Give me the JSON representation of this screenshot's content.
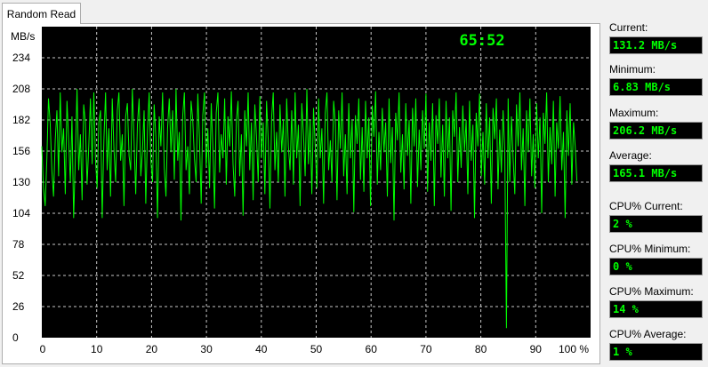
{
  "tab": {
    "label": "Random Read"
  },
  "timer": "65:52",
  "stats": [
    {
      "label": "Current:",
      "value": "131.2 MB/s"
    },
    {
      "label": "Minimum:",
      "value": "6.83 MB/s"
    },
    {
      "label": "Maximum:",
      "value": "206.2 MB/s"
    },
    {
      "label": "Average:",
      "value": "165.1 MB/s"
    },
    {
      "label": "CPU% Current:",
      "value": "2 %"
    },
    {
      "label": "CPU% Minimum:",
      "value": "0 %"
    },
    {
      "label": "CPU% Maximum:",
      "value": "14 %"
    },
    {
      "label": "CPU% Average:",
      "value": "1 %"
    }
  ],
  "colors": {
    "plot_bg": "#000000",
    "line": "#00ff00",
    "grid": "#c8c8c8",
    "value_text": "#00ff00"
  },
  "chart_data": {
    "type": "line",
    "title": "",
    "xlabel": "",
    "ylabel": "MB/s",
    "x_unit": "%",
    "xlim": [
      0,
      100
    ],
    "ylim": [
      0,
      260
    ],
    "y_ticks": [
      0,
      26,
      52,
      78,
      104,
      130,
      156,
      182,
      208,
      234
    ],
    "x_ticks": [
      "0",
      "10",
      "20",
      "30",
      "40",
      "50",
      "60",
      "70",
      "80",
      "90",
      "100 %"
    ],
    "grid": true,
    "series": [
      {
        "values": [
          160,
          125,
          110,
          150,
          200,
          180,
          140,
          118,
          165,
          190,
          135,
          205,
          155,
          175,
          120,
          198,
          165,
          130,
          185,
          100,
          150,
          208,
          140,
          170,
          115,
          195,
          180,
          128,
          160,
          200,
          145,
          205,
          150,
          125,
          180,
          190,
          100,
          165,
          205,
          140,
          175,
          118,
          200,
          158,
          130,
          190,
          205,
          148,
          170,
          110,
          185,
          196,
          152,
          140,
          208,
          165,
          120,
          178,
          200,
          135,
          155,
          190,
          112,
          172,
          205,
          148,
          130,
          195,
          168,
          100,
          185,
          160,
          205,
          142,
          118,
          175,
          200,
          155,
          190,
          132,
          208,
          148,
          172,
          98,
          185,
          205,
          140,
          160,
          120,
          198,
          182,
          150,
          130,
          204,
          165,
          112,
          186,
          205,
          142,
          175,
          125,
          196,
          158,
          108,
          188,
          205,
          138,
          170,
          150,
          200,
          128,
          185,
          160,
          206,
          145,
          118,
          182,
          198,
          135,
          170,
          102,
          190,
          160,
          205,
          140,
          180,
          115,
          195,
          168,
          130,
          202,
          150,
          180,
          120,
          198,
          165,
          108,
          184,
          205,
          140,
          172,
          130,
          195,
          155,
          182,
          118,
          200,
          160,
          140,
          190,
          128,
          205,
          150,
          178,
          110,
          196,
          170,
          135,
          208,
          145,
          182,
          120,
          192,
          160,
          125,
          200,
          150,
          175,
          112,
          188,
          205,
          140,
          165,
          130,
          198,
          180,
          115,
          190,
          158,
          205,
          135,
          170,
          120,
          196,
          150,
          182,
          105,
          186,
          162,
          200,
          132,
          176,
          122,
          198,
          150,
          184,
          110,
          194,
          168,
          206,
          128,
          172,
          140,
          192,
          155,
          180,
          118,
          200,
          146,
          176,
          98,
          188,
          165,
          205,
          138,
          170,
          124,
          196,
          152,
          182,
          112,
          192,
          160,
          200,
          126,
          174,
          140,
          190,
          158,
          204,
          122,
          180,
          148,
          196,
          110,
          186,
          162,
          200,
          134,
          178,
          118,
          198,
          150,
          184,
          106,
          190,
          168,
          205,
          130,
          176,
          142,
          194,
          156,
          182,
          120,
          198,
          148,
          178,
          100,
          188,
          160,
          204,
          135,
          172,
          128,
          196,
          150,
          184,
          112,
          192,
          166,
          200,
          124,
          174,
          138,
          190,
          156,
          8,
          200,
          130,
          185,
          150,
          120,
          195,
          160,
          205,
          140,
          175,
          110,
          190,
          155,
          200,
          135,
          170,
          125,
          196,
          150,
          184,
          104,
          188,
          162,
          205,
          130,
          176,
          145,
          198,
          118,
          180,
          158,
          202,
          140,
          172,
          100,
          190,
          152,
          196,
          128,
          180,
          160,
          131
        ]
      }
    ]
  }
}
